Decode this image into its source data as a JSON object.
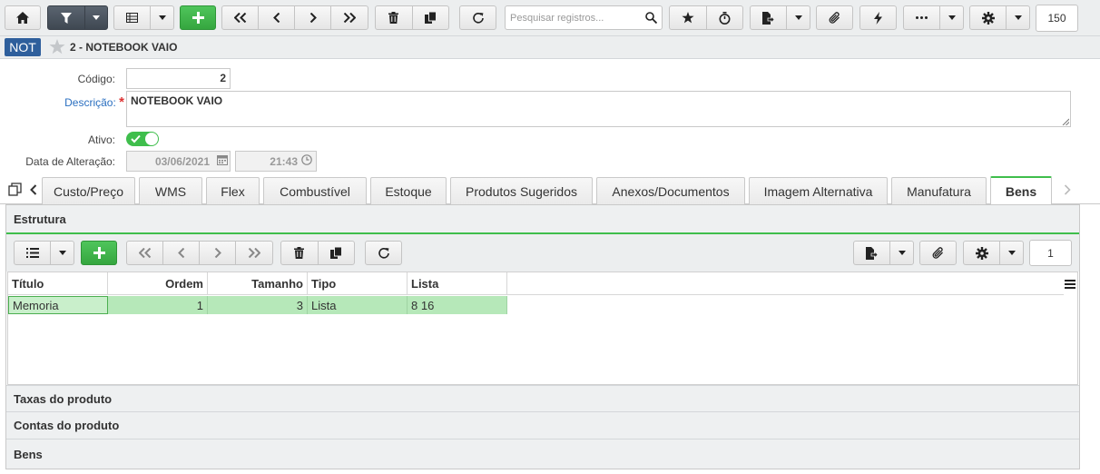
{
  "toolbar": {
    "search_placeholder": "Pesquisar registros...",
    "record_count": "150"
  },
  "header": {
    "badge": "NOT",
    "title": "2 - NOTEBOOK VAIO"
  },
  "form": {
    "codigo_label": "Código:",
    "codigo_value": "2",
    "descricao_label": "Descrição:",
    "required_mark": "*",
    "descricao_value": "NOTEBOOK VAIO",
    "ativo_label": "Ativo:",
    "ativo_value": true,
    "data_label": "Data de Alteração:",
    "data_value": "03/06/2021",
    "hora_value": "21:43"
  },
  "tabs": [
    {
      "label": "Custo/Preço"
    },
    {
      "label": "WMS"
    },
    {
      "label": "Flex"
    },
    {
      "label": "Combustível"
    },
    {
      "label": "Estoque"
    },
    {
      "label": "Produtos Sugeridos"
    },
    {
      "label": "Anexos/Documentos"
    },
    {
      "label": "Imagem Alternativa"
    },
    {
      "label": "Manufatura"
    },
    {
      "label": "Bens"
    }
  ],
  "active_tab": "Bens",
  "sections": {
    "estrutura": "Estrutura",
    "taxas": "Taxas do produto",
    "contas": "Contas do produto",
    "bens": "Bens"
  },
  "subtoolbar": {
    "record_count": "1"
  },
  "grid": {
    "columns": [
      "Título",
      "Ordem",
      "Tamanho",
      "Tipo",
      "Lista"
    ],
    "rows": [
      {
        "titulo": "Memoria",
        "ordem": "1",
        "tamanho": "3",
        "tipo": "Lista",
        "lista": "8 16"
      }
    ]
  },
  "colors": {
    "accent_green": "#3fbe4c",
    "badge_blue": "#2e5f9c",
    "row_highlight": "#b6e8b9",
    "label_blue": "#2a6fc0"
  }
}
